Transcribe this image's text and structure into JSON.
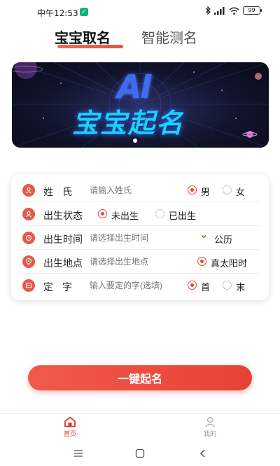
{
  "status_bar": {
    "time": "中午12:53",
    "battery": "99"
  },
  "top_tabs": {
    "active": "宝宝取名",
    "inactive": "智能测名"
  },
  "banner": {
    "ai_text": "AI",
    "title": "宝宝起名",
    "page_indicator": "1 of 1"
  },
  "form": {
    "surname": {
      "label": "姓氏",
      "placeholder": "请输入姓氏",
      "gender_male": "男",
      "gender_female": "女",
      "gender_selected": "男"
    },
    "birth_status": {
      "label": "出生状态",
      "not_born": "未出生",
      "born": "已出生",
      "selected": "未出生"
    },
    "birth_time": {
      "label": "出生时间",
      "placeholder": "请选择出生时间",
      "calendar": "公历"
    },
    "birth_place": {
      "label": "出生地点",
      "placeholder": "请选择出生地点",
      "solar_time": "真太阳时",
      "solar_time_checked": true
    },
    "fixed_char": {
      "label": "定字",
      "placeholder": "输入要定的字(选填)",
      "first": "首",
      "last": "末",
      "selected": "首"
    }
  },
  "actions": {
    "generate_label": "一键起名"
  },
  "bottom_nav": {
    "home": "首页",
    "mine": "我的"
  },
  "colors": {
    "accent": "#e04a3a",
    "banner_bg": "#11142b",
    "banner_title": "#1ad3f0",
    "ai_blue": "#3e6df0"
  },
  "icons": {
    "home": "home-icon",
    "mine": "user-icon",
    "row": "circle-badge-icon"
  }
}
